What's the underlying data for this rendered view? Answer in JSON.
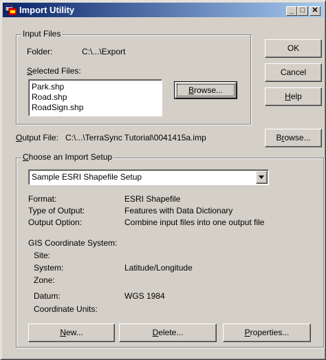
{
  "window": {
    "title": "Import Utility",
    "controls": [
      "_",
      "□",
      "✕"
    ]
  },
  "input_files": {
    "group_label": "Input Files",
    "folder_label": "Folder:",
    "folder_value": "C:\\...\\Export",
    "selected_label_u": "S",
    "selected_label_rest": "elected Files:",
    "files": [
      "Park.shp",
      "Road.shp",
      "RoadSign.shp"
    ],
    "browse_u": "B",
    "browse_rest": "rowse..."
  },
  "buttons": {
    "ok": "OK",
    "cancel": "Cancel",
    "help_u": "H",
    "help_rest": "elp"
  },
  "output": {
    "label_u": "O",
    "label_rest": "utput File:",
    "path": "C:\\...\\TerraSync Tutorial\\0041415a.imp",
    "browse_pre": "B",
    "browse_u": "r",
    "browse_rest": "owse..."
  },
  "setup": {
    "group_label_u": "C",
    "group_label_rest": "hoose an Import Setup",
    "selected": "Sample ESRI Shapefile Setup",
    "rows": [
      {
        "label": "Format:",
        "value": "ESRI Shapefile"
      },
      {
        "label": "Type of Output:",
        "value": "Features with Data Dictionary"
      },
      {
        "label": "Output Option:",
        "value": "Combine input files into one output file"
      }
    ],
    "gis_heading": "GIS Coordinate System:",
    "gis_rows": [
      {
        "label": "Site:",
        "value": ""
      },
      {
        "label": "System:",
        "value": "Latitude/Longitude"
      },
      {
        "label": "Zone:",
        "value": ""
      },
      {
        "label": "Datum:",
        "value": "WGS 1984"
      },
      {
        "label": "Coordinate Units:",
        "value": ""
      }
    ],
    "new_u": "N",
    "new_rest": "ew...",
    "delete_u": "D",
    "delete_rest": "elete...",
    "properties_u": "P",
    "properties_rest": "roperties..."
  }
}
